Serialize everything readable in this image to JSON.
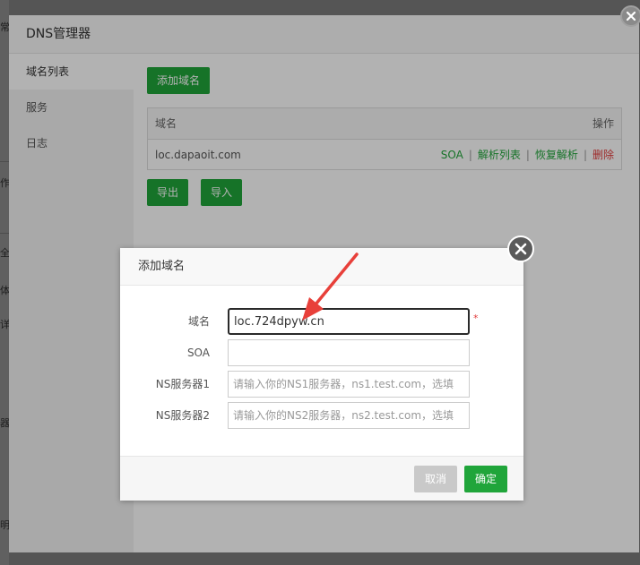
{
  "main_window": {
    "title": "DNS管理器",
    "sidebar": [
      {
        "label": "域名列表",
        "active": true
      },
      {
        "label": "服务",
        "active": false
      },
      {
        "label": "日志",
        "active": false
      }
    ],
    "add_domain_button": "添加域名",
    "table": {
      "headers": {
        "domain": "域名",
        "actions": "操作"
      },
      "rows": [
        {
          "domain": "loc.dapaoit.com",
          "soa": "SOA",
          "records": "解析列表",
          "restore": "恢复解析",
          "delete": "删除"
        }
      ]
    },
    "export_button": "导出",
    "import_button": "导入"
  },
  "background_fragments": [
    "常",
    "作",
    "全",
    "体",
    "详",
    "器",
    "明"
  ],
  "dialog": {
    "title": "添加域名",
    "fields": {
      "domain": {
        "label": "域名",
        "value": "loc.724dpyw.cn",
        "required_mark": "*"
      },
      "soa": {
        "label": "SOA",
        "value": ""
      },
      "ns1": {
        "label": "NS服务器1",
        "placeholder": "请输入你的NS1服务器，ns1.test.com，选填"
      },
      "ns2": {
        "label": "NS服务器2",
        "placeholder": "请输入你的NS2服务器，ns2.test.com，选填"
      }
    },
    "cancel_button": "取消",
    "confirm_button": "确定"
  },
  "colors": {
    "primary_green": "#20a53a",
    "danger_red": "#e23c3c",
    "annotation_red": "#e8403a"
  }
}
